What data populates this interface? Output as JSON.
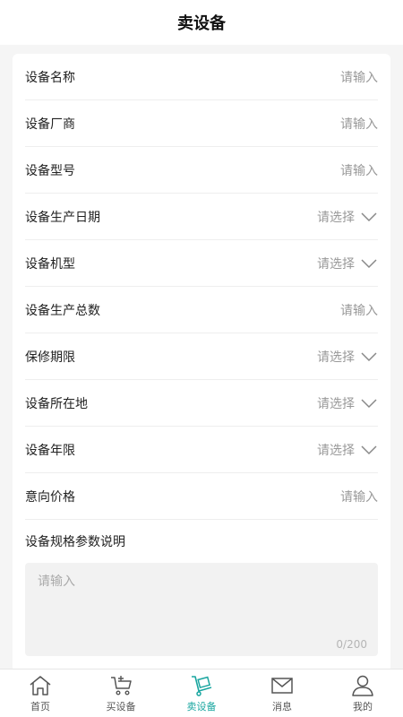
{
  "header": {
    "title": "卖设备"
  },
  "form": {
    "rows": [
      {
        "label": "设备名称",
        "placeholder": "请输入",
        "type": "input"
      },
      {
        "label": "设备厂商",
        "placeholder": "请输入",
        "type": "input"
      },
      {
        "label": "设备型号",
        "placeholder": "请输入",
        "type": "input"
      },
      {
        "label": "设备生产日期",
        "placeholder": "请选择",
        "type": "select"
      },
      {
        "label": "设备机型",
        "placeholder": "请选择",
        "type": "select"
      },
      {
        "label": "设备生产总数",
        "placeholder": "请输入",
        "type": "input"
      },
      {
        "label": "保修期限",
        "placeholder": "请选择",
        "type": "select"
      },
      {
        "label": "设备所在地",
        "placeholder": "请选择",
        "type": "select"
      },
      {
        "label": "设备年限",
        "placeholder": "请选择",
        "type": "select"
      },
      {
        "label": "意向价格",
        "placeholder": "请输入",
        "type": "input"
      }
    ],
    "description": {
      "label": "设备规格参数说明",
      "placeholder": "请输入",
      "counter": "0/200"
    }
  },
  "tabbar": {
    "items": [
      {
        "label": "首页",
        "icon": "home-icon",
        "active": false
      },
      {
        "label": "买设备",
        "icon": "cart-icon",
        "active": false
      },
      {
        "label": "卖设备",
        "icon": "hand-truck-icon",
        "active": true
      },
      {
        "label": "消息",
        "icon": "mail-icon",
        "active": false
      },
      {
        "label": "我的",
        "icon": "user-icon",
        "active": false
      }
    ]
  },
  "colors": {
    "accent": "#1aa6a0",
    "background": "#f5f5f5",
    "placeholder": "#999999"
  }
}
